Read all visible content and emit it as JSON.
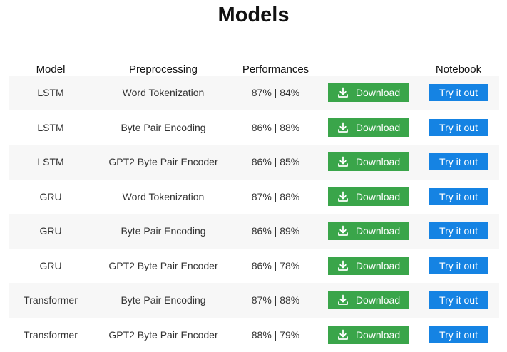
{
  "page": {
    "title": "Models"
  },
  "table": {
    "headers": {
      "model": "Model",
      "preprocessing": "Preprocessing",
      "performances": "Performances",
      "download": "",
      "notebook": "Notebook"
    },
    "rows": [
      {
        "model": "LSTM",
        "preprocessing": "Word Tokenization",
        "performances": "87% | 84%",
        "download_label": "Download",
        "notebook_label": "Try it out"
      },
      {
        "model": "LSTM",
        "preprocessing": "Byte Pair Encoding",
        "performances": "86% | 88%",
        "download_label": "Download",
        "notebook_label": "Try it out"
      },
      {
        "model": "LSTM",
        "preprocessing": "GPT2 Byte Pair Encoder",
        "performances": "86% | 85%",
        "download_label": "Download",
        "notebook_label": "Try it out"
      },
      {
        "model": "GRU",
        "preprocessing": "Word Tokenization",
        "performances": "87% | 88%",
        "download_label": "Download",
        "notebook_label": "Try it out"
      },
      {
        "model": "GRU",
        "preprocessing": "Byte Pair Encoding",
        "performances": "86% | 89%",
        "download_label": "Download",
        "notebook_label": "Try it out"
      },
      {
        "model": "GRU",
        "preprocessing": "GPT2 Byte Pair Encoder",
        "performances": "86% | 78%",
        "download_label": "Download",
        "notebook_label": "Try it out"
      },
      {
        "model": "Transformer",
        "preprocessing": "Byte Pair Encoding",
        "performances": "87% | 88%",
        "download_label": "Download",
        "notebook_label": "Try it out"
      },
      {
        "model": "Transformer",
        "preprocessing": "GPT2 Byte Pair Encoder",
        "performances": "88% | 79%",
        "download_label": "Download",
        "notebook_label": "Try it out"
      }
    ]
  },
  "icons": {
    "download": "download-icon"
  },
  "colors": {
    "download_button": "#3aa54a",
    "notebook_button": "#1583e3",
    "row_shade": "#f7f7f7"
  }
}
